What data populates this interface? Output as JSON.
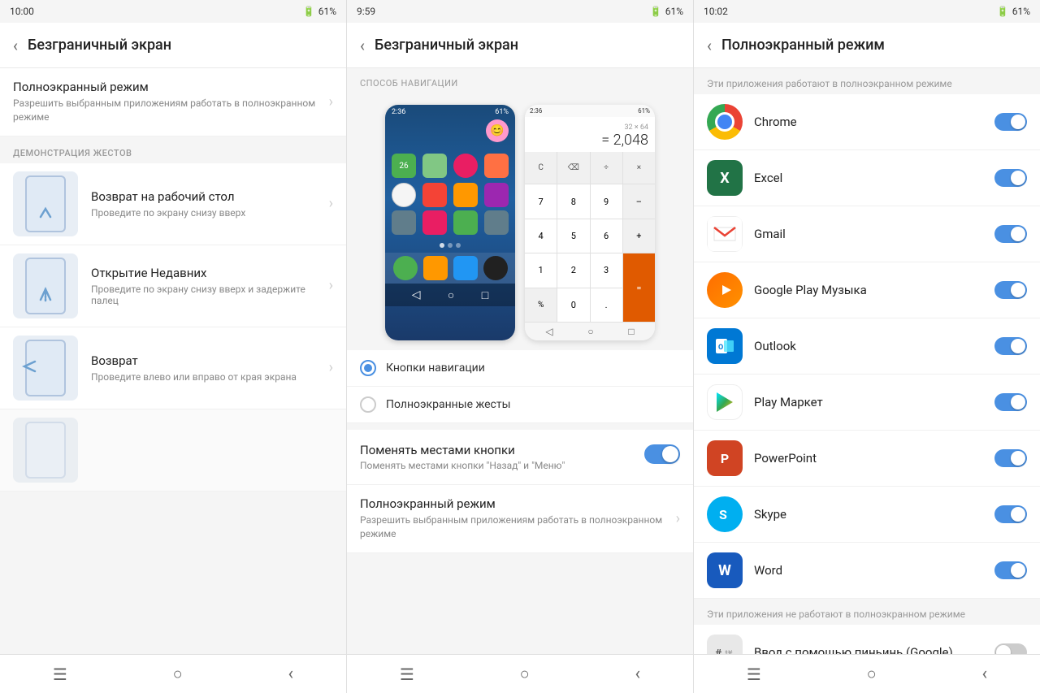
{
  "statusBars": [
    {
      "time": "10:00",
      "battery": "61%",
      "id": "panel1"
    },
    {
      "time": "9:59",
      "battery": "61%",
      "id": "panel2"
    },
    {
      "time": "10:02",
      "battery": "61%",
      "id": "panel3"
    }
  ],
  "panel1": {
    "title": "Безграничный экран",
    "fullscreenItem": {
      "title": "Полноэкранный режим",
      "subtitle": "Разрешить выбранным приложениям работать в полноэкранном режиме"
    },
    "gestureSectionLabel": "ДЕМОНСТРАЦИЯ ЖЕСТОВ",
    "gestures": [
      {
        "title": "Возврат на рабочий стол",
        "desc": "Проведите по экрану снизу вверх",
        "type": "home"
      },
      {
        "title": "Открытие Недавних",
        "desc": "Проведите по экрану снизу вверх и задержите палец",
        "type": "recent"
      },
      {
        "title": "Возврат",
        "desc": "Проведите влево или вправо от края экрана",
        "type": "back"
      }
    ]
  },
  "panel2": {
    "title": "Безграничный экран",
    "navSectionLabel": "СПОСОБ НАВИГАЦИИ",
    "phoneTime": "2:36",
    "calcResult": "= 2,048",
    "calcRow1": [
      "32",
      "×",
      "64"
    ],
    "calcButtons": [
      "C",
      "⌫",
      "÷",
      "×",
      "7",
      "8",
      "9",
      "–",
      "4",
      "5",
      "6",
      "+",
      "1",
      "2",
      "3",
      "=",
      "%",
      "0",
      ".",
      "="
    ],
    "navOptions": [
      {
        "label": "Кнопки навигации",
        "selected": true
      },
      {
        "label": "Полноэкранные жесты",
        "selected": false
      }
    ],
    "swapToggle": {
      "title": "Поменять местами кнопки",
      "subtitle": "Поменять местами кнопки \"Назад\" и \"Меню\"",
      "on": true
    },
    "fullscreenItem": {
      "title": "Полноэкранный режим",
      "subtitle": "Разрешить выбранным приложениям работать в полноэкранном режиме"
    }
  },
  "panel3": {
    "title": "Полноэкранный режим",
    "fullscreenAppsLabel": "Эти приложения работают в полноэкранном режиме",
    "apps": [
      {
        "name": "Chrome",
        "type": "chrome",
        "enabled": true
      },
      {
        "name": "Excel",
        "type": "excel",
        "enabled": true
      },
      {
        "name": "Gmail",
        "type": "gmail",
        "enabled": true
      },
      {
        "name": "Google Play Музыка",
        "type": "gplay",
        "enabled": true
      },
      {
        "name": "Outlook",
        "type": "outlook",
        "enabled": true
      },
      {
        "name": "Play Маркет",
        "type": "playmarket",
        "enabled": true
      },
      {
        "name": "PowerPoint",
        "type": "ppt",
        "enabled": true
      },
      {
        "name": "Skype",
        "type": "skype",
        "enabled": true
      },
      {
        "name": "Word",
        "type": "word",
        "enabled": true
      }
    ],
    "notFullscreenLabel": "Эти приложения не работают в полноэкранном режиме",
    "notFullscreenApps": [
      {
        "name": "Ввод с помощью пиньинь (Google)",
        "type": "pinyin",
        "enabled": false
      }
    ]
  },
  "bottomNav": {
    "menu": "☰",
    "home": "○",
    "back": "‹"
  }
}
